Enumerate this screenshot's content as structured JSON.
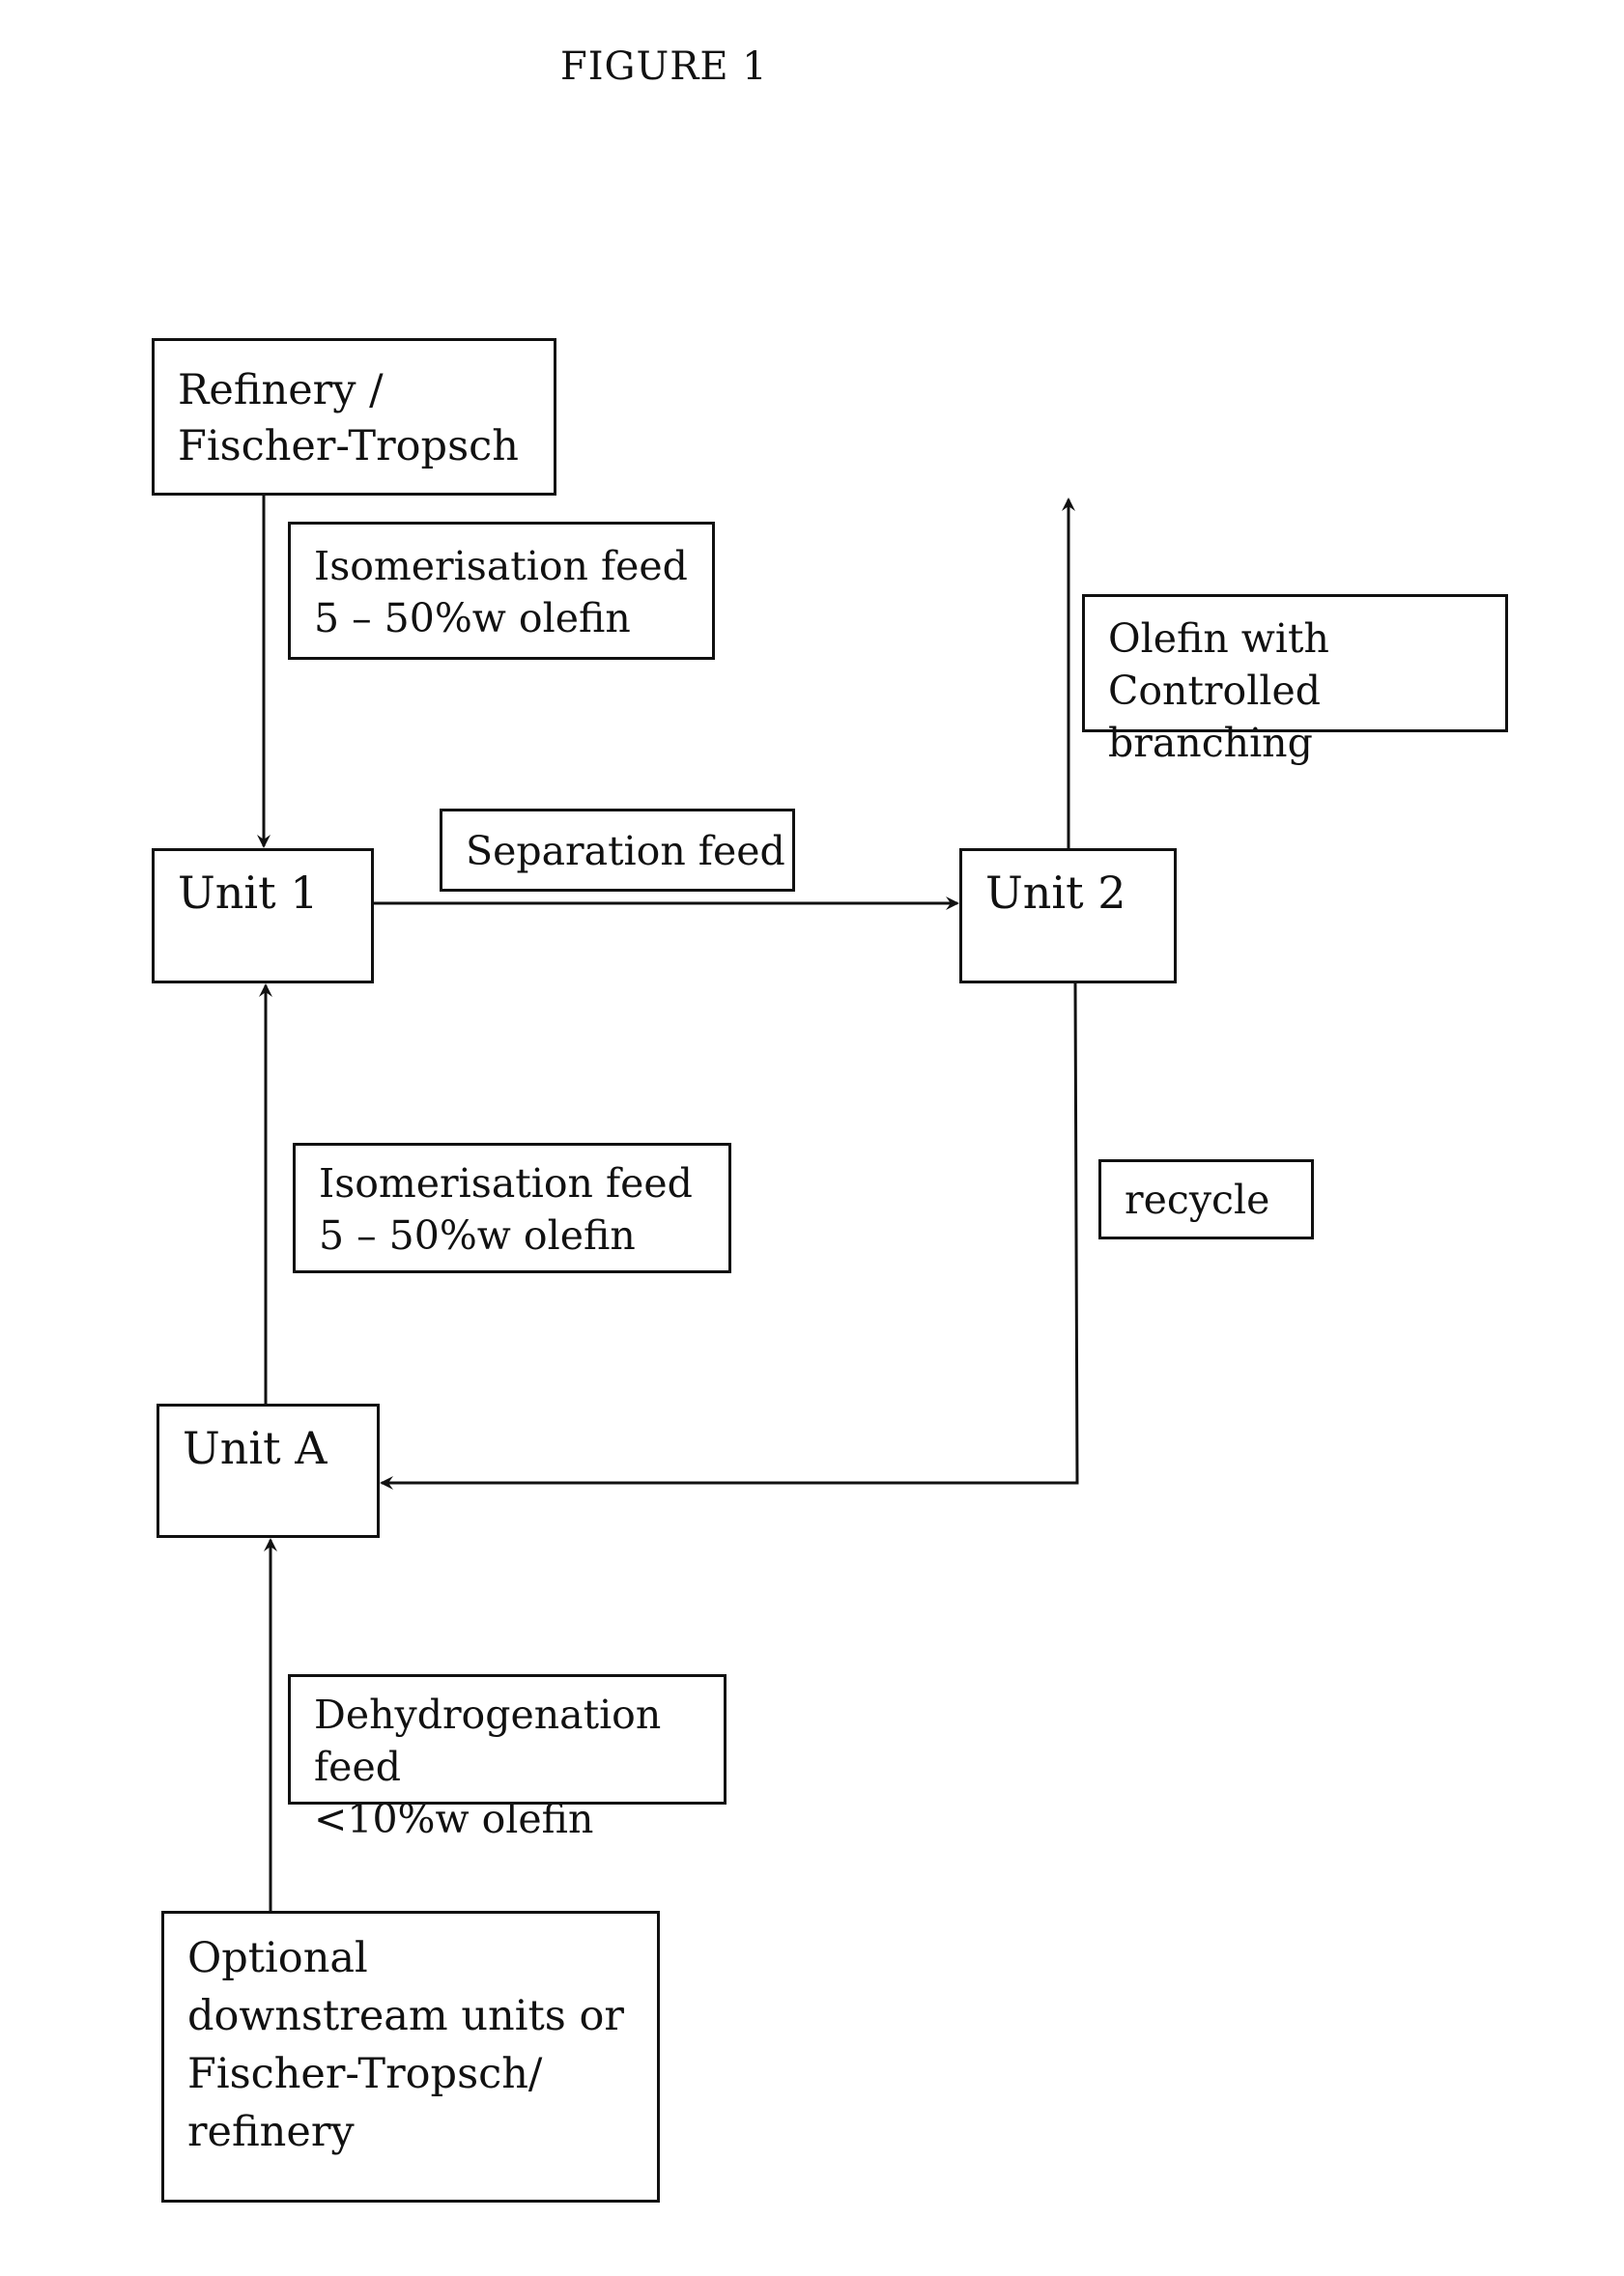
{
  "figure": {
    "title": "FIGURE 1"
  },
  "nodes": {
    "refinery": {
      "text": "Refinery /\nFischer-Tropsch"
    },
    "unit1": {
      "text": "Unit 1"
    },
    "unit2": {
      "text": "Unit 2"
    },
    "unitA": {
      "text": "Unit A"
    },
    "source": {
      "text": "Optional\ndownstream units or\nFischer-Tropsch/\nrefinery"
    }
  },
  "labels": {
    "isom_feed_top": {
      "text": "Isomerisation feed\n5 – 50%w olefin"
    },
    "separation_feed": {
      "text": "Separation feed"
    },
    "product": {
      "text": "Olefin with Controlled\nbranching"
    },
    "isom_feed_bottom": {
      "text": "Isomerisation feed\n5 – 50%w olefin"
    },
    "recycle": {
      "text": "recycle"
    },
    "dehydro_feed": {
      "text": "Dehydrogenation feed\n<10%w olefin"
    }
  },
  "edges": [
    {
      "from": "refinery",
      "to": "unit1",
      "label": "isom_feed_top"
    },
    {
      "from": "unit1",
      "to": "unit2",
      "label": "separation_feed"
    },
    {
      "from": "unit2",
      "to": "output",
      "label": "product"
    },
    {
      "from": "unit2",
      "to": "unitA",
      "label": "recycle"
    },
    {
      "from": "unitA",
      "to": "unit1",
      "label": "isom_feed_bottom"
    },
    {
      "from": "source",
      "to": "unitA",
      "label": "dehydro_feed"
    }
  ]
}
